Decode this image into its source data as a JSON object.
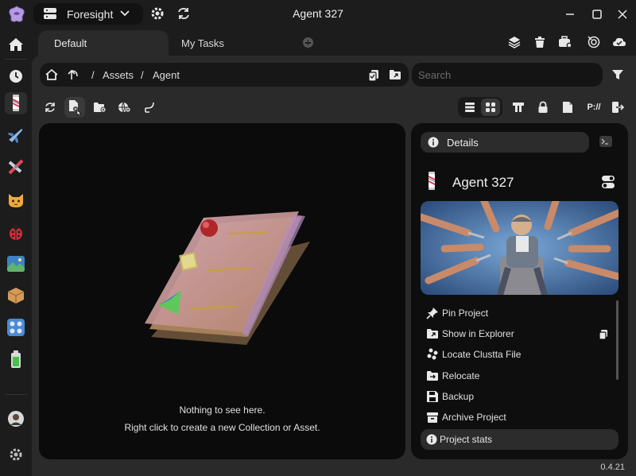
{
  "titlebar": {
    "workspace_name": "Foresight",
    "window_title": "Agent 327"
  },
  "tabs": [
    {
      "label": "Default",
      "active": true
    },
    {
      "label": "My Tasks",
      "active": false
    }
  ],
  "breadcrumb": {
    "items": [
      "Assets",
      "Agent"
    ],
    "separator": "/"
  },
  "search": {
    "placeholder": "Search",
    "value": ""
  },
  "content": {
    "empty_title": "Nothing to see here.",
    "empty_hint": "Right click to create a new Collection or Asset."
  },
  "toolbar_right": {
    "path_label": "P://"
  },
  "details": {
    "header_label": "Details",
    "project_name": "Agent 327",
    "actions": [
      {
        "label": "Pin Project",
        "icon": "pin-icon"
      },
      {
        "label": "Show in Explorer",
        "icon": "folder-open-icon"
      },
      {
        "label": "Locate Clustta File",
        "icon": "locate-icon"
      },
      {
        "label": "Relocate",
        "icon": "folder-move-icon"
      },
      {
        "label": "Backup",
        "icon": "save-icon"
      },
      {
        "label": "Archive Project",
        "icon": "archive-icon"
      }
    ],
    "stats_label": "Project stats"
  },
  "sidebar": {
    "projects": [
      "barber-pole-icon",
      "jet-icon",
      "airplane-icon",
      "cat-icon",
      "ladybug-icon",
      "landscape-icon",
      "package-icon",
      "control-knobs-icon",
      "battery-icon"
    ]
  },
  "version": "0.4.21",
  "colors": {
    "background": "#1c1c1c",
    "panel": "#2a2a2a",
    "content": "#0b0b0b"
  }
}
